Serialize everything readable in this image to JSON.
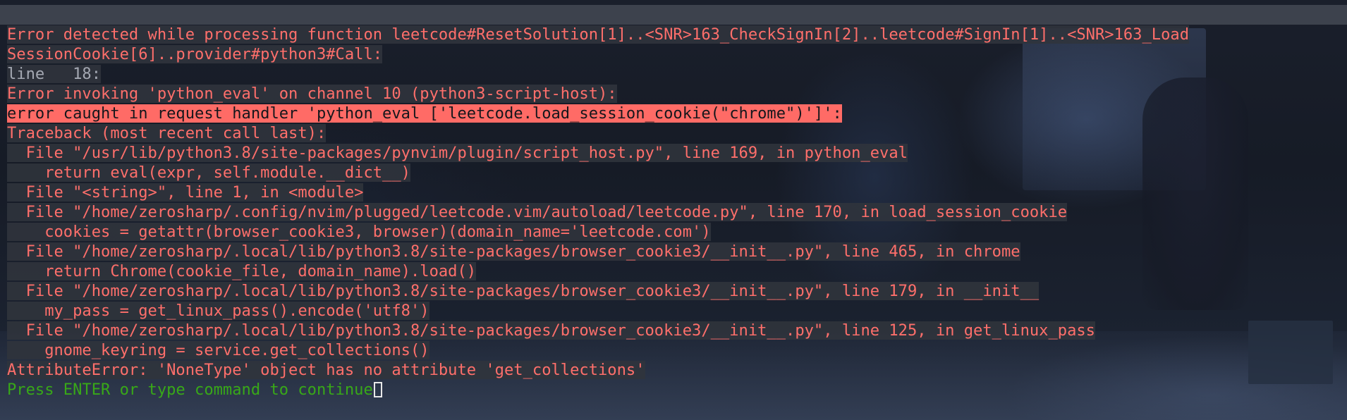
{
  "terminal": {
    "lines": [
      "Error detected while processing function leetcode#ResetSolution[1]..<SNR>163_CheckSignIn[2]..leetcode#SignIn[1]..<SNR>163_Load",
      "SessionCookie[6]..provider#python3#Call:",
      "line   18:",
      "Error invoking 'python_eval' on channel 10 (python3-script-host):",
      "error caught in request handler 'python_eval ['leetcode.load_session_cookie(\"chrome\")']':",
      "Traceback (most recent call last):",
      "  File \"/usr/lib/python3.8/site-packages/pynvim/plugin/script_host.py\", line 169, in python_eval",
      "    return eval(expr, self.module.__dict__)",
      "  File \"<string>\", line 1, in <module>",
      "  File \"/home/zerosharp/.config/nvim/plugged/leetcode.vim/autoload/leetcode.py\", line 170, in load_session_cookie",
      "    cookies = getattr(browser_cookie3, browser)(domain_name='leetcode.com')",
      "  File \"/home/zerosharp/.local/lib/python3.8/site-packages/browser_cookie3/__init__.py\", line 465, in chrome",
      "    return Chrome(cookie_file, domain_name).load()",
      "  File \"/home/zerosharp/.local/lib/python3.8/site-packages/browser_cookie3/__init__.py\", line 179, in __init__",
      "    my_pass = get_linux_pass().encode('utf8')",
      "  File \"/home/zerosharp/.local/lib/python3.8/site-packages/browser_cookie3/__init__.py\", line 125, in get_linux_pass",
      "    gnome_keyring = service.get_collections()",
      "AttributeError: 'NoneType' object has no attribute 'get_collections'"
    ],
    "prompt": "Press ENTER or type command to continue"
  },
  "colors": {
    "error_text": "#ff6f6b",
    "line_number_text": "#a4a8b2",
    "highlight_background": "#ff6b66",
    "prompt_text": "#38a818",
    "text_background": "#30343c"
  }
}
